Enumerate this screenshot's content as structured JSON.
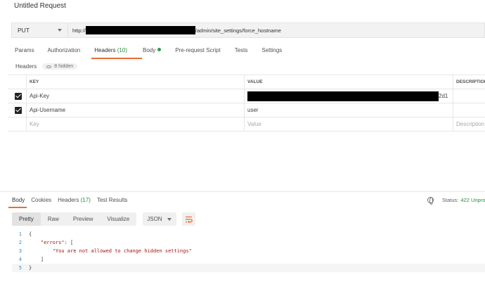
{
  "request": {
    "title": "Untitled Request",
    "method": "PUT",
    "url_prefix": "http://",
    "url_suffix": "/admin/site_settings/force_hostname"
  },
  "request_tabs": [
    {
      "label": "Params"
    },
    {
      "label": "Authorization"
    },
    {
      "label": "Headers",
      "count": "(10)"
    },
    {
      "label": "Body"
    },
    {
      "label": "Pre-request Script"
    },
    {
      "label": "Tests"
    },
    {
      "label": "Settings"
    }
  ],
  "headers_section": {
    "title": "Headers",
    "hidden_label": "8 hidden"
  },
  "table": {
    "columns": [
      "KEY",
      "VALUE",
      "DESCRIPTION"
    ],
    "rows": [
      {
        "checked": true,
        "key": "Api-Key",
        "value_suffix": "2d1",
        "description": ""
      },
      {
        "checked": true,
        "key": "Api-Username",
        "value": "user",
        "description": ""
      }
    ],
    "placeholder": {
      "key": "Key",
      "value": "Value",
      "description": "Description"
    }
  },
  "response_tabs": [
    {
      "label": "Body"
    },
    {
      "label": "Cookies"
    },
    {
      "label": "Headers",
      "count": "(17)"
    },
    {
      "label": "Test Results"
    }
  ],
  "status": {
    "label": "Status:",
    "value": "422 Unpro"
  },
  "view_options": [
    "Pretty",
    "Raw",
    "Preview",
    "Visualize"
  ],
  "format": "JSON",
  "code_lines": [
    {
      "n": "1",
      "text": "{"
    },
    {
      "n": "2",
      "text": "    \"errors\": ["
    },
    {
      "n": "3",
      "text": "        \"You are not allowed to change hidden settings\""
    },
    {
      "n": "4",
      "text": "    ]"
    },
    {
      "n": "5",
      "text": "}"
    }
  ],
  "colors": {
    "accent": "#e66d33",
    "status_green": "#2a8d3c",
    "code_string": "#a31515",
    "line_number": "#3b8cc8"
  }
}
